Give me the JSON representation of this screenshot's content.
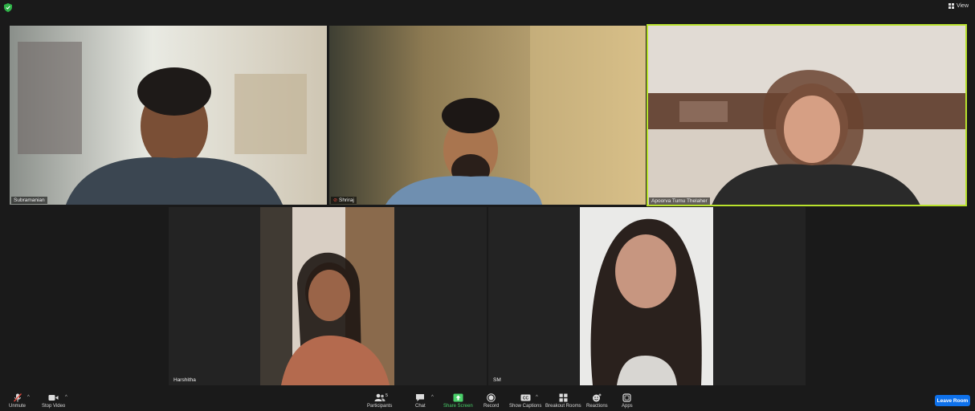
{
  "top": {
    "view_label": "View"
  },
  "participants": [
    {
      "name": "Subramanian",
      "muted": false
    },
    {
      "name": "Shriraj",
      "muted": true
    },
    {
      "name": "Apoorva Tumu Thelaher",
      "muted": false,
      "active_speaker": true
    },
    {
      "name": "Harshitha",
      "muted": false
    },
    {
      "name": "SM",
      "muted": false
    }
  ],
  "toolbar": {
    "unmute": "Unmute",
    "stop_video": "Stop Video",
    "participants": "Participants",
    "participants_count": "5",
    "chat": "Chat",
    "share_screen": "Share Screen",
    "record": "Record",
    "show_captions": "Show Captions",
    "breakout_rooms": "Breakout Rooms",
    "reactions": "Reactions",
    "apps": "Apps",
    "leave_room": "Leave Room"
  },
  "colors": {
    "background": "#1a1a1a",
    "active_border": "#b9e22d",
    "share_green": "#4ad06a",
    "leave_blue": "#0e71eb",
    "muted_red": "#e0473b"
  }
}
